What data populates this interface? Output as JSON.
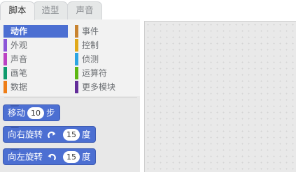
{
  "tabs": [
    {
      "label": "脚本",
      "active": true
    },
    {
      "label": "造型",
      "active": false
    },
    {
      "label": "声音",
      "active": false
    }
  ],
  "categories": [
    {
      "label": "动作",
      "color": "#4c6fd2",
      "selected": true
    },
    {
      "label": "外观",
      "color": "#8a55d7",
      "selected": false
    },
    {
      "label": "声音",
      "color": "#bb42c3",
      "selected": false
    },
    {
      "label": "画笔",
      "color": "#0e9a6c",
      "selected": false
    },
    {
      "label": "数据",
      "color": "#ee7d16",
      "selected": false
    },
    {
      "label": "事件",
      "color": "#c88330",
      "selected": false
    },
    {
      "label": "控制",
      "color": "#e1a91a",
      "selected": false
    },
    {
      "label": "侦测",
      "color": "#2ca5e2",
      "selected": false
    },
    {
      "label": "运算符",
      "color": "#5cb712",
      "selected": false
    },
    {
      "label": "更多模块",
      "color": "#632d99",
      "selected": false
    }
  ],
  "blocks": [
    {
      "pre": "移动",
      "value": "10",
      "post": "步",
      "icon": ""
    },
    {
      "pre": "向右旋转",
      "value": "15",
      "post": "度",
      "icon": "rotate-right-icon"
    },
    {
      "pre": "向左旋转",
      "value": "15",
      "post": "度",
      "icon": "rotate-left-icon"
    }
  ],
  "colors": {
    "motion": "#4c6fd2",
    "palette_bg": "#e8e8e8",
    "scripts_bg": "#e9e9e9"
  }
}
